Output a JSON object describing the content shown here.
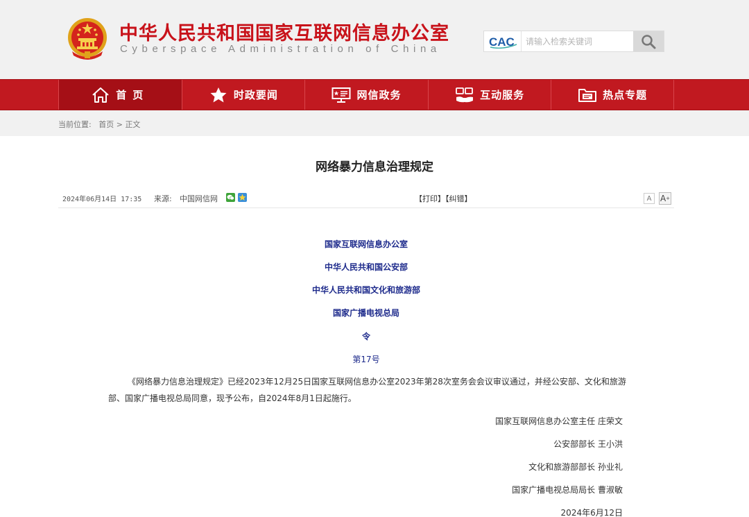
{
  "header": {
    "title": "中华人民共和国国家互联网信息办公室",
    "subtitle": "Cyberspace Administration of China",
    "search_logo": "CAC",
    "search_placeholder": "请输入检索关键词",
    "colors": {
      "brand_red": "#c8121a",
      "nav_red": "#c11920"
    }
  },
  "nav": {
    "items": [
      {
        "label": "首页",
        "icon": "home-icon"
      },
      {
        "label": "时政要闻",
        "icon": "star-icon"
      },
      {
        "label": "网信政务",
        "icon": "monitor-icon"
      },
      {
        "label": "互动服务",
        "icon": "handshake-icon"
      },
      {
        "label": "热点专题",
        "icon": "folder-icon"
      }
    ]
  },
  "breadcrumb": {
    "prefix": "当前位置:",
    "home": "首页",
    "separator": ">",
    "current": "正文"
  },
  "article": {
    "title": "网络暴力信息治理规定",
    "date": "2024年06月14日 17:35",
    "source_label": "来源:",
    "source": "中国网信网",
    "print": "【打印】",
    "correct": "【纠错】",
    "font_small": "A",
    "font_large": "A",
    "issuers": [
      "国家互联网信息办公室",
      "中华人民共和国公安部",
      "中华人民共和国文化和旅游部",
      "国家广播电视总局",
      "令",
      "第17号"
    ],
    "body": "《网络暴力信息治理规定》已经2023年12月25日国家互联网信息办公室2023年第28次室务会会议审议通过，并经公安部、文化和旅游部、国家广播电视总局同意，现予公布，自2024年8月1日起施行。",
    "signatures": [
      "国家互联网信息办公室主任 庄荣文",
      "公安部部长 王小洪",
      "文化和旅游部部长 孙业礼",
      "国家广播电视总局局长 曹淑敏",
      "2024年6月12日"
    ]
  }
}
